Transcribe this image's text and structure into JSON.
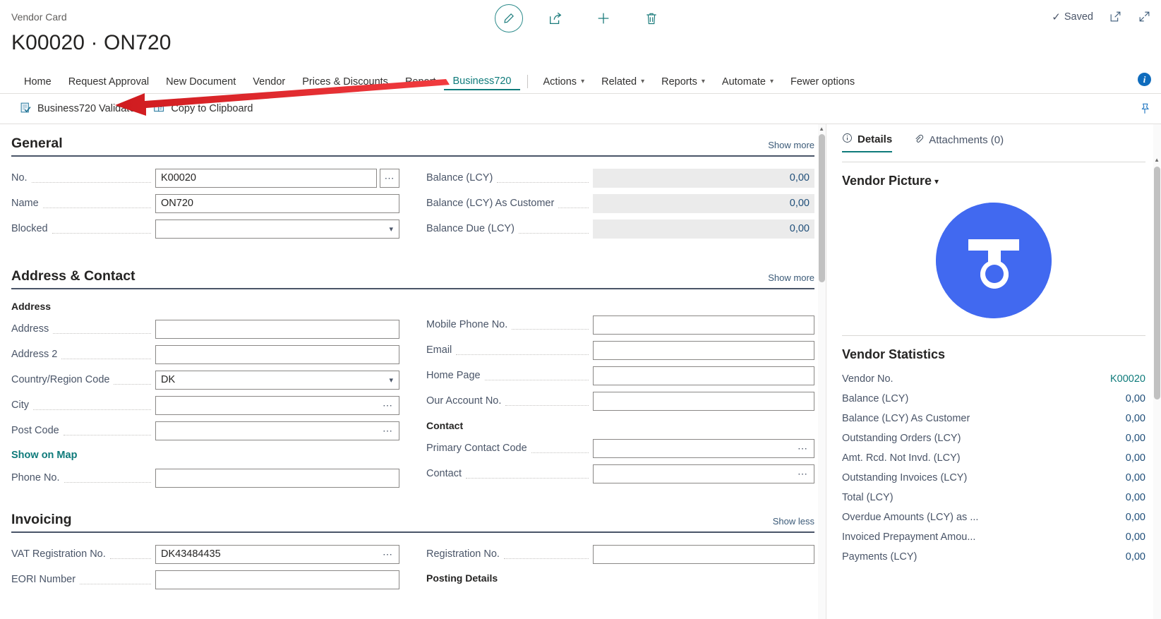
{
  "breadcrumb": "Vendor Card",
  "page_title": "K00020 · ON720",
  "topbar": {
    "edit_icon": "pencil-icon",
    "share_icon": "share-icon",
    "new_icon": "plus-icon",
    "delete_icon": "trash-icon",
    "saved_label": "Saved",
    "open_new_window_icon": "open-in-new-window-icon",
    "collapse_icon": "collapse-icon",
    "info_badge": "i"
  },
  "menu": {
    "items": [
      {
        "label": "Home",
        "active": false,
        "caret": false
      },
      {
        "label": "Request Approval",
        "active": false,
        "caret": false
      },
      {
        "label": "New Document",
        "active": false,
        "caret": false
      },
      {
        "label": "Vendor",
        "active": false,
        "caret": false
      },
      {
        "label": "Prices & Discounts",
        "active": false,
        "caret": false
      },
      {
        "label": "Report",
        "active": false,
        "caret": false
      },
      {
        "label": "Business720",
        "active": true,
        "caret": false
      }
    ],
    "items2": [
      {
        "label": "Actions",
        "active": false,
        "caret": true
      },
      {
        "label": "Related",
        "active": false,
        "caret": true
      },
      {
        "label": "Reports",
        "active": false,
        "caret": true
      },
      {
        "label": "Automate",
        "active": false,
        "caret": true
      },
      {
        "label": "Fewer options",
        "active": false,
        "caret": false
      }
    ]
  },
  "actionbar": {
    "items": [
      {
        "label": "Business720 Validate",
        "icon": "validate-document-icon"
      },
      {
        "label": "Copy to Clipboard",
        "icon": "clipboard-icon"
      }
    ],
    "pin_icon": "pin-icon"
  },
  "general": {
    "title": "General",
    "show_toggle": "Show more",
    "left_fields": [
      {
        "label": "No.",
        "value": "K00020",
        "type": "text",
        "lookup": true
      },
      {
        "label": "Name",
        "value": "ON720",
        "type": "text",
        "lookup": false
      },
      {
        "label": "Blocked",
        "value": "",
        "type": "select",
        "lookup": false
      }
    ],
    "right_fields": [
      {
        "label": "Balance (LCY)",
        "value": "0,00"
      },
      {
        "label": "Balance (LCY) As Customer",
        "value": "0,00"
      },
      {
        "label": "Balance Due (LCY)",
        "value": "0,00"
      }
    ]
  },
  "address_contact": {
    "title": "Address & Contact",
    "show_toggle": "Show more",
    "left_subhead": "Address",
    "left_fields": [
      {
        "label": "Address",
        "value": "",
        "type": "text",
        "ellipsis": false
      },
      {
        "label": "Address 2",
        "value": "",
        "type": "text",
        "ellipsis": false
      },
      {
        "label": "Country/Region Code",
        "value": "DK",
        "type": "select",
        "ellipsis": false
      },
      {
        "label": "City",
        "value": "",
        "type": "text",
        "ellipsis": true
      },
      {
        "label": "Post Code",
        "value": "",
        "type": "text",
        "ellipsis": true
      }
    ],
    "map_link": "Show on Map",
    "left_fields_after": [
      {
        "label": "Phone No.",
        "value": "",
        "type": "text",
        "ellipsis": false
      }
    ],
    "right_fields": [
      {
        "label": "Mobile Phone No.",
        "value": "",
        "type": "text",
        "ellipsis": false
      },
      {
        "label": "Email",
        "value": "",
        "type": "text",
        "ellipsis": false
      },
      {
        "label": "Home Page",
        "value": "",
        "type": "text",
        "ellipsis": false
      },
      {
        "label": "Our Account No.",
        "value": "",
        "type": "text",
        "ellipsis": false
      }
    ],
    "right_subhead": "Contact",
    "right_fields_after": [
      {
        "label": "Primary Contact Code",
        "value": "",
        "type": "text",
        "ellipsis": true
      },
      {
        "label": "Contact",
        "value": "",
        "type": "text",
        "ellipsis": true
      }
    ]
  },
  "invoicing": {
    "title": "Invoicing",
    "show_toggle": "Show less",
    "left_fields": [
      {
        "label": "VAT Registration No.",
        "value": "DK43484435",
        "type": "text",
        "lookup": true
      },
      {
        "label": "EORI Number",
        "value": "",
        "type": "text",
        "lookup": false
      }
    ],
    "right_fields": [
      {
        "label": "Registration No.",
        "value": "",
        "type": "text"
      }
    ],
    "right_subhead": "Posting Details"
  },
  "side": {
    "tabs": [
      {
        "label": "Details",
        "icon": "info-circle-icon",
        "active": true
      },
      {
        "label": "Attachments (0)",
        "icon": "paperclip-icon",
        "active": false
      }
    ],
    "picture_title": "Vendor Picture",
    "stats_title": "Vendor Statistics",
    "stats": [
      {
        "label": "Vendor No.",
        "value": "K00020",
        "link": true
      },
      {
        "label": "Balance (LCY)",
        "value": "0,00",
        "link": true
      },
      {
        "label": "Balance (LCY) As Customer",
        "value": "0,00",
        "link": false
      },
      {
        "label": "Outstanding Orders (LCY)",
        "value": "0,00",
        "link": true
      },
      {
        "label": "Amt. Rcd. Not Invd. (LCY)",
        "value": "0,00",
        "link": true
      },
      {
        "label": "Outstanding Invoices (LCY)",
        "value": "0,00",
        "link": true
      },
      {
        "label": "Total (LCY)",
        "value": "0,00",
        "link": false
      },
      {
        "label": "Overdue Amounts (LCY) as ...",
        "value": "0,00",
        "link": true
      },
      {
        "label": "Invoiced Prepayment Amou...",
        "value": "0,00",
        "link": false
      },
      {
        "label": "Payments (LCY)",
        "value": "0,00",
        "link": true
      }
    ]
  },
  "colors": {
    "accent_teal": "#0f7b7b",
    "link_blue": "#1f4e79",
    "logo_blue": "#4169f0",
    "arrow_red": "#e8262a"
  }
}
